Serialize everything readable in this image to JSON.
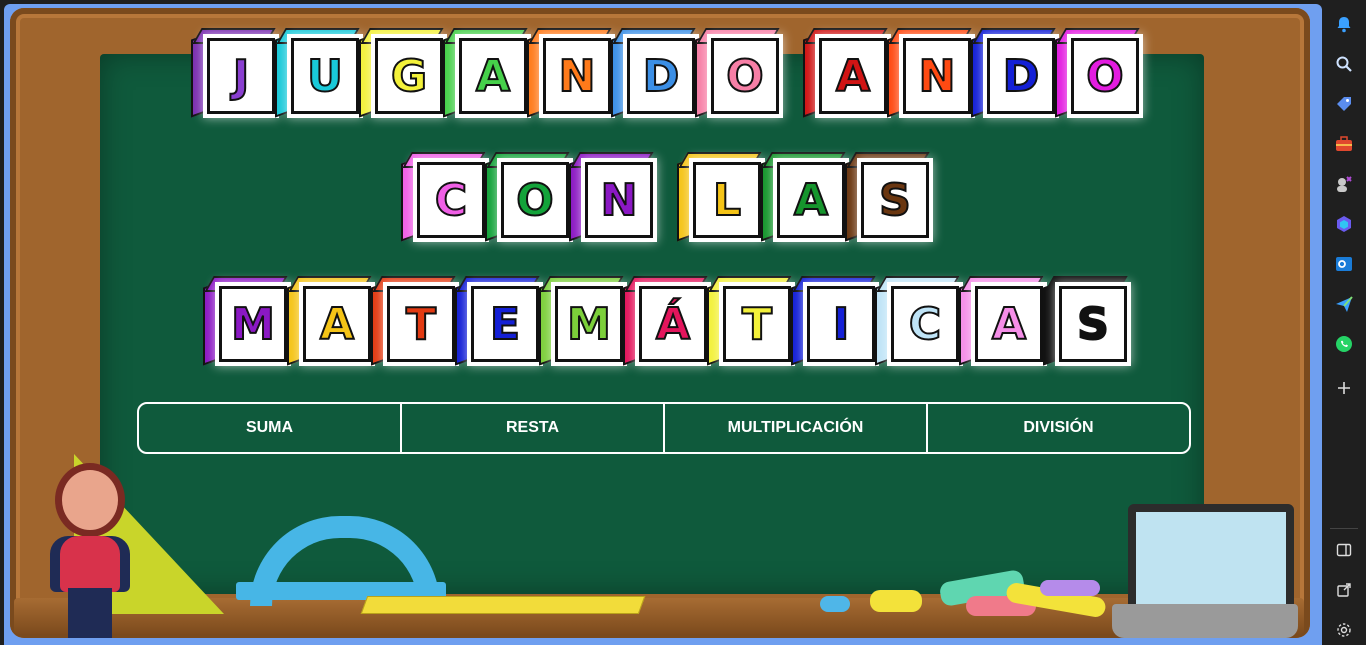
{
  "title_rows": [
    [
      [
        {
          "l": "J",
          "face": "#7a2fb0",
          "fill": "#8a3fd0"
        },
        {
          "l": "U",
          "face": "#19c9d9",
          "fill": "#19c9d9"
        },
        {
          "l": "G",
          "face": "#f3f13a",
          "fill": "#f3f13a"
        },
        {
          "l": "A",
          "face": "#46d04a",
          "fill": "#46d04a"
        },
        {
          "l": "N",
          "face": "#ff7a1a",
          "fill": "#ff7a1a"
        },
        {
          "l": "D",
          "face": "#3b8fe6",
          "fill": "#3b8fe6"
        },
        {
          "l": "O",
          "face": "#f77fa6",
          "fill": "#f77fa6"
        }
      ],
      [
        {
          "l": "A",
          "face": "#d01414",
          "fill": "#d01414"
        },
        {
          "l": "N",
          "face": "#ff4a12",
          "fill": "#ff4a12"
        },
        {
          "l": "D",
          "face": "#1420d6",
          "fill": "#1420d6"
        },
        {
          "l": "O",
          "face": "#e31ce0",
          "fill": "#e31ce0"
        }
      ]
    ],
    [
      [
        {
          "l": "C",
          "face": "#f05fe6",
          "fill": "#f05fe6"
        },
        {
          "l": "O",
          "face": "#13a33a",
          "fill": "#13a33a"
        },
        {
          "l": "N",
          "face": "#8b18c4",
          "fill": "#8b18c4"
        }
      ],
      [
        {
          "l": "L",
          "face": "#f5c417",
          "fill": "#f5c417"
        },
        {
          "l": "A",
          "face": "#16952d",
          "fill": "#16952d"
        },
        {
          "l": "S",
          "face": "#6a3610",
          "fill": "#6a3610"
        }
      ]
    ],
    [
      [
        {
          "l": "M",
          "face": "#8b18c4",
          "fill": "#8b18c4"
        },
        {
          "l": "A",
          "face": "#f5c417",
          "fill": "#f5c417"
        },
        {
          "l": "T",
          "face": "#e33a12",
          "fill": "#e33a12"
        },
        {
          "l": "E",
          "face": "#1420d6",
          "fill": "#1420d6"
        },
        {
          "l": "M",
          "face": "#7ccf3a",
          "fill": "#7ccf3a"
        },
        {
          "l": "Á",
          "face": "#e3155c",
          "fill": "#e3155c"
        },
        {
          "l": "T",
          "face": "#f3f13a",
          "fill": "#f3f13a"
        },
        {
          "l": "I",
          "face": "#1420d6",
          "fill": "#1420d6"
        },
        {
          "l": "C",
          "face": "#bfe4f7",
          "fill": "#bfe4f7"
        },
        {
          "l": "A",
          "face": "#f58ee8",
          "fill": "#f58ee8"
        },
        {
          "l": "S",
          "face": "#111111",
          "fill": "#111111"
        }
      ]
    ]
  ],
  "tabs": [
    {
      "label": "SUMA"
    },
    {
      "label": "RESTA"
    },
    {
      "label": "MULTIPLICACIÓN"
    },
    {
      "label": "DIVISIÓN"
    }
  ],
  "sidebar": {
    "icons": [
      "bell-icon",
      "search-icon",
      "tag-icon",
      "toolbox-icon",
      "games-icon",
      "copilot-icon",
      "outlook-icon",
      "send-icon",
      "whatsapp-icon",
      "add-icon"
    ],
    "bottom_icons": [
      "split-view-icon",
      "open-external-icon",
      "settings-icon"
    ]
  },
  "colors": {
    "board": "#0f5a3c",
    "frame": "#a0652d",
    "background": "#6f9ff0"
  }
}
